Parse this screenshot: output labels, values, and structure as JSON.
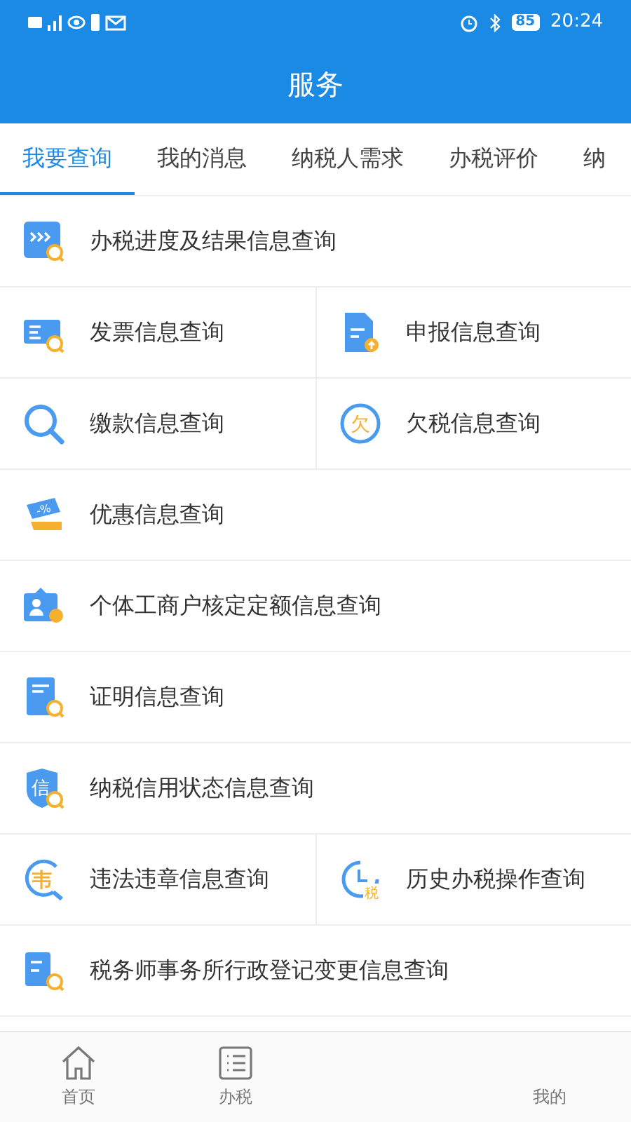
{
  "status_bar": {
    "battery": "85",
    "time": "20:24"
  },
  "header": {
    "title": "服务"
  },
  "tabs": [
    {
      "label": "我要查询",
      "selected": true
    },
    {
      "label": "我的消息",
      "selected": false
    },
    {
      "label": "纳税人需求",
      "selected": false
    },
    {
      "label": "办税评价",
      "selected": false
    },
    {
      "label": "纳",
      "selected": false
    }
  ],
  "rows": [
    [
      {
        "label": "办税进度及结果信息查询",
        "kind": "progress"
      }
    ],
    [
      {
        "label": "发票信息查询",
        "kind": "invoice"
      },
      {
        "label": "申报信息查询",
        "kind": "declare"
      }
    ],
    [
      {
        "label": "缴款信息查询",
        "kind": "search"
      },
      {
        "label": "欠税信息查询",
        "kind": "circle",
        "glyph": "欠"
      }
    ],
    [
      {
        "label": "优惠信息查询",
        "kind": "discount",
        "glyph": "-%"
      }
    ],
    [
      {
        "label": "个体工商户核定定额信息查询",
        "kind": "person"
      }
    ],
    [
      {
        "label": "证明信息查询",
        "kind": "certificate"
      }
    ],
    [
      {
        "label": "纳税信用状态信息查询",
        "kind": "shield",
        "glyph": "信"
      }
    ],
    [
      {
        "label": "违法违章信息查询",
        "kind": "ring",
        "glyph": "韦"
      },
      {
        "label": "历史办税操作查询",
        "kind": "clock",
        "glyph": "税"
      }
    ],
    [
      {
        "label": "税务师事务所行政登记变更信息查询",
        "kind": "agent"
      }
    ]
  ],
  "bottom_nav": [
    {
      "label": "首页",
      "kind": "home"
    },
    {
      "label": "办税",
      "kind": "list"
    },
    {
      "label": "我的",
      "kind": "none"
    }
  ]
}
